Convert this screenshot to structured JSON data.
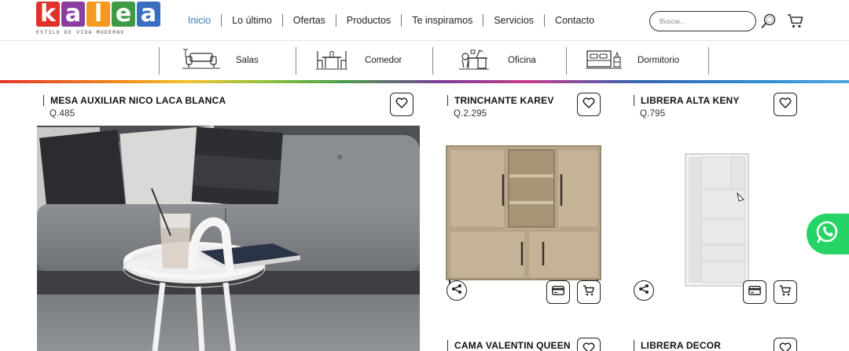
{
  "brand": {
    "logo_letters": [
      "k",
      "a",
      "l",
      "e",
      "a"
    ],
    "logo_colors": [
      "#e0322b",
      "#8a3fa0",
      "#f39a1f",
      "#3f9a45",
      "#3a6fc0"
    ],
    "tagline": "ESTILO DE VIDA MODERNO"
  },
  "nav": {
    "items": [
      "Inicio",
      "Lo último",
      "Ofertas",
      "Productos",
      "Te inspiramos",
      "Servicios",
      "Contacto"
    ],
    "active": "Inicio",
    "search_placeholder": "Buscar...",
    "search_icon": "magnifier-icon",
    "cart_icon": "cart-icon"
  },
  "categories": [
    {
      "label": "Salas",
      "icon": "sofa-icon"
    },
    {
      "label": "Comedor",
      "icon": "dining-table-icon"
    },
    {
      "label": "Oficina",
      "icon": "desk-icon"
    },
    {
      "label": "Dormitorio",
      "icon": "bed-icon"
    }
  ],
  "products": [
    {
      "name": "MESA AUXILIAR NICO LACA BLANCA",
      "price": "Q.485"
    },
    {
      "name": "TRINCHANTE KAREV",
      "price": "Q.2.295"
    },
    {
      "name": "LIBRERA ALTA KENY",
      "price": "Q.795"
    },
    {
      "name": "CAMA VALENTIN QUEEN",
      "price": ""
    },
    {
      "name": "LIBRERA DECOR",
      "price": ""
    }
  ],
  "actions": {
    "wishlist_icon": "heart-icon",
    "share_icon": "share-icon",
    "credit_icon": "credit-card-icon",
    "add_cart_icon": "cart-icon"
  },
  "whatsapp": {
    "icon": "whatsapp-icon",
    "color": "#25d366"
  },
  "colors": {
    "accent": "#3c7bb8"
  }
}
